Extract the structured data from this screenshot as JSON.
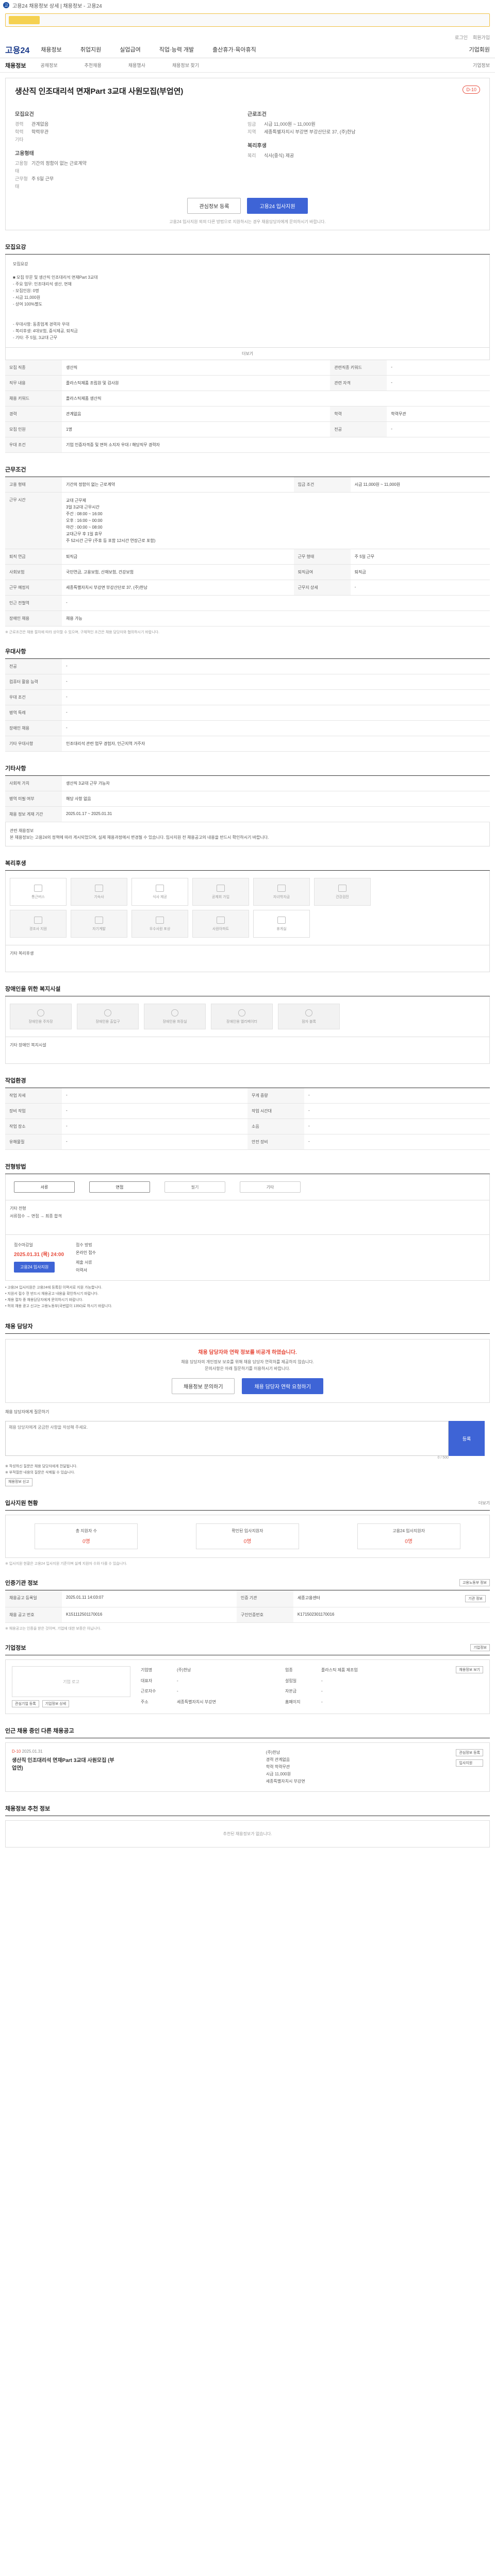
{
  "browser": {
    "crumb": "고용24 채용정보 상세 | 채용정보 - 고용24"
  },
  "util": [
    "로그인",
    "회원가입"
  ],
  "gnb": {
    "logo": "고용24",
    "items": [
      "채용정보",
      "취업지원",
      "실업급여",
      "직업·능력 개발",
      "출산휴가·육아휴직"
    ],
    "right": "기업회원"
  },
  "subnav": {
    "crumb": "채용정보",
    "items": [
      "공채정보",
      "추천채용",
      "채용행사",
      "채용정보 찾기"
    ],
    "right": "기업정보"
  },
  "job": {
    "title": "생산직 인조대리석 면재Part 3교대 사원모집(부업연)",
    "dday": "D-10",
    "recruit_h": "모집요건",
    "cond_h": "근로조건",
    "req": [
      [
        "경력",
        "관계없음"
      ],
      [
        "학력",
        "학력무관"
      ],
      [
        "기타",
        ""
      ]
    ],
    "cond": [
      [
        "임금",
        "시급 11,000원 ~ 11,000원"
      ],
      [
        "지역",
        "세종특별자치시 부강면 부강산단로 37, (주)한남",
        "(주)"
      ]
    ],
    "emp_h": "고용형태",
    "emp": [
      [
        "고용형태",
        "기간의 정함이 없는 근로계약"
      ],
      [
        "근무형태",
        "주 5일 근무"
      ]
    ],
    "welfare_h": "복리후생",
    "welfare": [
      [
        "복리",
        "식사(중식) 제공"
      ]
    ],
    "btn_save": "관심정보 등록",
    "btn_apply": "고용24 입사지원",
    "note": "고용24 입사지원 외의 다른 방법으로 지원하시는 경우 채용담당자에게 문의하시기 바랍니다."
  },
  "sections": {
    "recruit_h": "모집요강",
    "desc": "모집요강\n\n■ 모집 부문 및 생산직 인조대리석 면재Part 3교대\n  - 주요 업무: 인조대리석 생산, 면재\n  - 모집인원: 0명\n  - 시급 11,000원\n  - 상여 100%별도\n\n\n  - 우대사항: 동종업계 경력자 우대\n  - 복리후생: 4대보험, 중식제공, 퇴직금\n  - 기타: 주 5일, 3교대 근무",
    "more": "더보기",
    "recruit": [
      [
        "모집 직종",
        "생산직",
        "관련직종 키워드",
        "-"
      ],
      [
        "직무 내용",
        "플라스틱제품 조립원 및 검사원",
        "관련 자격",
        "-"
      ],
      [
        "채용 키워드",
        "플라스틱제품 생산직",
        null,
        null
      ],
      [
        "경력",
        "관계없음",
        "학력",
        "학력무관"
      ],
      [
        "모집 인원",
        "1명",
        "전공",
        "-"
      ],
      [
        "우대 조건",
        "기업 인증자격증 및 면허 소지자 우대 / 해당직무 경력자",
        null,
        null
      ]
    ],
    "cond_h": "근무조건",
    "cond": [
      [
        "고용 형태",
        "기간의 정함이 없는 근로계약",
        "임금 조건",
        "시급 11,000원 ~ 11,000원"
      ],
      [
        "근무 시간",
        "교대 근무제\n3일 3교대 근무시간\n주간 : 08:00 ~ 16:00\n오후 : 16:00 ~ 00:00\n야간 : 00:00 ~ 08:00\n교대근무 후 1일 휴무\n주 52시간 근무 (주휴 등 포함 12시간 연장근로 포함)",
        null,
        null
      ],
      [
        "퇴직 연금",
        "퇴직금",
        "근무 형태",
        "주 5일 근무"
      ],
      [
        "사회보험",
        "국민연금, 고용보험, 산재보험, 건강보험",
        "퇴직급여",
        "퇴직금"
      ],
      [
        "근무 예정지",
        "세종특별자치시 부강면 부강산단로 37, (주)한남",
        "근무지 상세",
        "-"
      ],
      [
        "인근 전철역",
        "-",
        null,
        null
      ],
      [
        "장애인 채용",
        "채용 가능",
        null,
        null
      ]
    ],
    "cond_note": "※ 근로조건은 채용 절차에 따라 상이할 수 있으며, 구체적인 조건은 채용 담당자와 협의하시기 바랍니다.",
    "apply_h": "우대사항",
    "apply": [
      [
        "전공",
        "-"
      ],
      [
        "컴퓨터 활용 능력",
        "-"
      ],
      [
        "우대 조건",
        "-"
      ],
      [
        "병역 특례",
        "-"
      ],
      [
        "장애인 채용",
        "-"
      ],
      [
        "기타 우대사항",
        "인조대리석 관련 업무 경험자, 인근지역 거주자"
      ]
    ],
    "etc_h": "기타사항",
    "etc": [
      [
        "사회적 가치",
        "생산직 3교대 근무 가능자"
      ],
      [
        "병역 미필 여부",
        "해당 사항 없음"
      ],
      [
        "채용 정보 게재 기간",
        "2025.01.17 ~ 2025.01.31"
      ]
    ],
    "etc_note": "관련 채용정보\n본 채용정보는 고용24의 정책에 따라 게시되었으며, 실제 채용과정에서 변경될 수 있습니다. 입사지원 전 채용공고의 내용을 반드시 확인하시기 바랍니다.",
    "welfare_h": "복리후생",
    "welfare_items": [
      "통근버스",
      "기숙사",
      "식사 제공",
      "공제회 가입",
      "자녀학자금",
      "건강검진",
      "경조사 지원",
      "자기계발",
      "우수사원 포상",
      "사원아파트",
      "휴게실"
    ],
    "welfare_extra_label": "기타 복리후생",
    "welfare_extra": "",
    "dis_h": "장애인을 위한 복지시설",
    "dis_items": [
      "장애인용 주차장",
      "장애인용 출입구",
      "장애인용 화장실",
      "장애인용 엘리베이터",
      "점자 블록"
    ],
    "dis_extra_label": "기타 장애인 복지시설",
    "dis_extra": "",
    "env_h": "작업환경",
    "env": [
      [
        "작업 자세",
        "-",
        "무게 중량",
        "-"
      ],
      [
        "장비 작업",
        "-",
        "작업 시간대",
        "-"
      ],
      [
        "작업 장소",
        "-",
        "소음",
        "-"
      ],
      [
        "유해물질",
        "-",
        "안전 장비",
        "-"
      ]
    ],
    "process_h": "전형방법",
    "steps": [
      "서류",
      "면접",
      "필기",
      "기타"
    ],
    "process_extra_label": "기타 전형",
    "process_extra": "서류접수 → 면접 → 최종 합격",
    "deadline_h": "접수마감일",
    "deadline": "2025.01.31 (목) 24:00",
    "deadline_method_label": "접수 방법",
    "deadline_method": "온라인 접수",
    "deadline_docs_label": "제출 서류",
    "deadline_docs": "이력서",
    "deadline_apply": "고용24 입사지원",
    "bullets": [
      "• 고용24 입사지원은 고용24에 등록된 이력서로 지원 가능합니다.",
      "• 지원서 접수 전 반드시 채용공고 내용을 확인하시기 바랍니다.",
      "• 채용 절차 중 채용담당자에게 문의하시기 바랍니다.",
      "• 허위 채용 광고 신고는 고용노동부(국번없이 1350)로 하시기 바랍니다."
    ]
  },
  "contact": {
    "title": "채용 담당자",
    "alert_title": "채용 담당자와 연락 정보를 비공개 하였습니다.",
    "alert_desc": "채용 담당자의 개인정보 보호를 위해 채용 담당자 연락처를 제공하지 않습니다.\n문의사항은 아래 질문하기를 이용하시기 바랍니다.",
    "btn_apply_inquiry": "채용정보 문의하기",
    "btn_contact": "채용 담당자 연락 요청하기",
    "qa_label": "채용 담당자에게 질문하기",
    "qa_placeholder": "채용 담당자에게 궁금한 사항을 작성해 주세요.",
    "qa_send": "등록",
    "qa_counts": "0 / 500",
    "notes": [
      "※ 작성하신 질문은 채용 담당자에게 전달됩니다.",
      "※ 부적절한 내용의 질문은 삭제될 수 있습니다."
    ],
    "notes_btn": "채용정보 신고"
  },
  "stats": {
    "title": "입사지원 현황",
    "more": "더보기",
    "items": [
      [
        "총 지원자 수",
        "0명"
      ],
      [
        "확인된 입사지원자",
        "0명"
      ],
      [
        "고용24 입사지원자",
        "0명"
      ]
    ],
    "note": "※ 입사지원 현황은 고용24 입사지원 기준이며 실제 지원자 수와 다를 수 있습니다."
  },
  "org": {
    "title": "인증기관 정보",
    "more": "고용노동부 정보",
    "rows": [
      [
        "채용공고 등록일",
        "2025.01.11 14:03:07",
        "인증 기관",
        "세종고용센터",
        "기관 정보"
      ],
      [
        "채용 공고 번호",
        "K151112501170016",
        "구인인증번호",
        "K171502301170016",
        ""
      ]
    ],
    "note": "※ 채용공고는 인증을 받은 것이며, 기업에 대한 보증은 아닙니다."
  },
  "company": {
    "title": "기업정보",
    "more": "기업정보",
    "logo": "기업 로고",
    "btn1": "관심기업 등록",
    "btn2": "기업정보 상세",
    "info": [
      [
        "기업명",
        "(주)한남",
        "업종",
        "플라스틱 제품 제조업"
      ],
      [
        "대표자",
        "-",
        "설립일",
        "-"
      ],
      [
        "근로자수",
        "-",
        "자본금",
        "-"
      ],
      [
        "주소",
        "세종특별자치시 부강면",
        "홈페이지",
        "-"
      ]
    ],
    "apply": "채용정보 보기"
  },
  "recommend": {
    "title": "인근 채용 중인 다른 채용공고",
    "dday": "D-10",
    "date": "2025.01.31",
    "name": "생산직 인조대리석 면재Part 3교대 사원모집 (부업연)",
    "company": "(주)한남",
    "cond": [
      "경력 관계없음",
      "학력 학력무관",
      "시급 11,000원",
      "세종특별자치시 부강면"
    ],
    "btn1": "관심정보 등록",
    "btn2": "입사지원"
  },
  "empty": {
    "title": "채용정보 추천 정보",
    "text": "추천된 채용정보가 없습니다."
  }
}
